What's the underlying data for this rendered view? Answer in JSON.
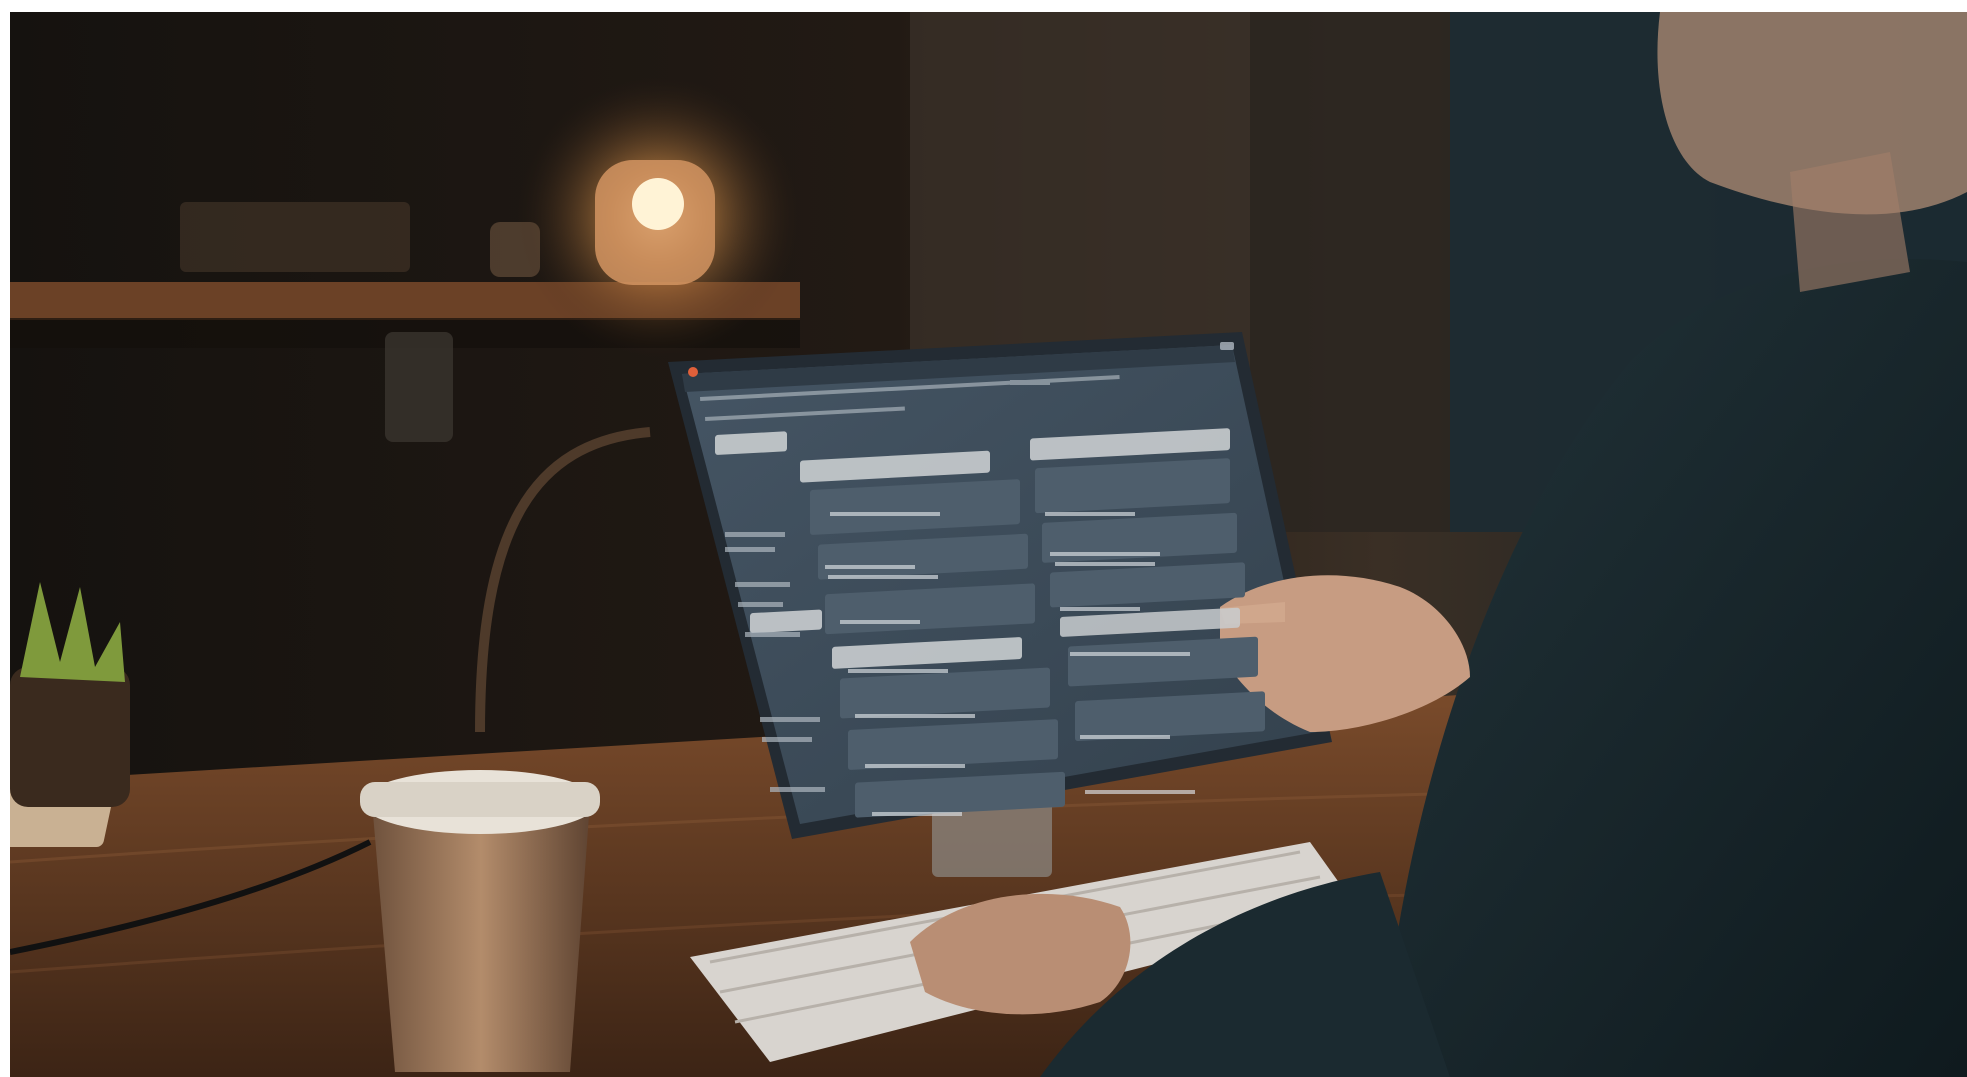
{
  "scene": {
    "description_labels": {
      "photo": "photo-scene",
      "monitor": "monitor",
      "screen": "screen"
    },
    "screen_text": {
      "window_title": "",
      "note": ""
    },
    "colors": {
      "wall": "#241c15",
      "shelf": "#7a4e2c",
      "lamp": "#ffd9a0",
      "desk": "#6a4127",
      "screen_bg": "#3d4c5a",
      "screen_panel": "#4a5a68",
      "screen_highlight": "#c9cdcf",
      "sweater": "#1d2b31",
      "skin": "#c9a089",
      "cup": "#a57e5f",
      "keyboard": "#d8d4cf"
    },
    "icons": [
      "close-icon",
      "window-controls-icon"
    ]
  }
}
